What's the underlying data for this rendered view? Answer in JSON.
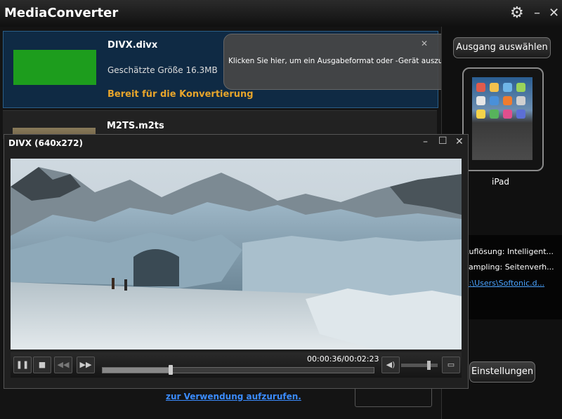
{
  "app": {
    "title": "MediaConverter"
  },
  "window_controls": {
    "settings_icon": "gear-icon",
    "minimize_icon": "minimize-icon",
    "close_icon": "close-icon"
  },
  "files": [
    {
      "name": "DIVX.divx",
      "size": "Geschätzte Größe 16.3MB",
      "status": "Bereit für die Konvertierung"
    },
    {
      "name": "M2TS.m2ts"
    }
  ],
  "tooltip": {
    "text": "Klicken Sie hier, um ein Ausgabeformat oder -Gerät auszuwählen."
  },
  "output": {
    "button_label": "Ausgang auswählen",
    "device_name": "iPad"
  },
  "settings_info": {
    "resolution": "Auflösung: Intelligent...",
    "sampling": "Sampling: Seitenverh...",
    "path": "C:\\Users\\Softonic.d..."
  },
  "settings_button": "Einstellungen",
  "bottom_link": "zur Verwendung aufzurufen.",
  "player": {
    "title": "DIVX (640x272)",
    "time": "00:00:36/00:02:23",
    "progress": 0.25,
    "volume": 0.75
  },
  "colors": {
    "accent_status": "#e7a52b",
    "selection_bg": "#0f2a44",
    "link": "#3b8cff"
  }
}
